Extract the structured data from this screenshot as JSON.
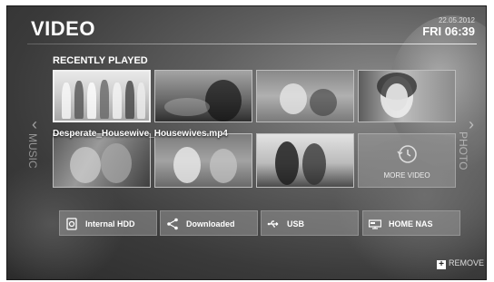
{
  "header": {
    "title": "VIDEO",
    "date": "22.05.2012",
    "time": "FRI 06:39"
  },
  "section_title": "RECENTLY PLAYED",
  "selected_file": "Desperate_Housewive_Housewives.mp4",
  "more_label": "MORE VIDEO",
  "side_nav": {
    "left": "MUSIC",
    "right": "PHOTO"
  },
  "devices": [
    {
      "label": "Internal HDD",
      "icon": "hdd-icon"
    },
    {
      "label": "Downloaded",
      "icon": "share-icon"
    },
    {
      "label": "USB",
      "icon": "usb-icon"
    },
    {
      "label": "HOME NAS",
      "icon": "nas-icon"
    }
  ],
  "remove_label": "REMOVE"
}
